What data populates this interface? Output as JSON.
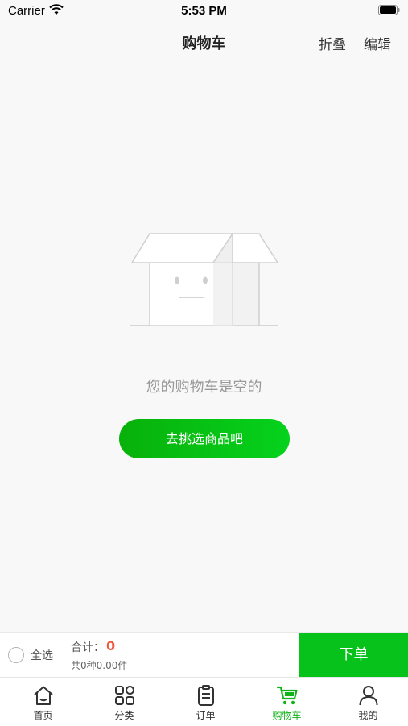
{
  "status_bar": {
    "carrier": "Carrier",
    "time": "5:53 PM",
    "icons": [
      "wifi-icon",
      "battery-icon"
    ]
  },
  "header": {
    "title": "购物车",
    "fold_label": "折叠",
    "edit_label": "编辑"
  },
  "empty_state": {
    "illustration": "empty-box-icon",
    "message": "您的购物车是空的",
    "button_label": "去挑选商品吧"
  },
  "checkout": {
    "select_all_label": "全选",
    "total_label": "合计：",
    "total_value": "0",
    "count_text": "共0种0.00件",
    "order_button_label": "下单"
  },
  "tabs": [
    {
      "label": "首页",
      "icon": "home-icon"
    },
    {
      "label": "分类",
      "icon": "category-icon"
    },
    {
      "label": "订单",
      "icon": "order-icon"
    },
    {
      "label": "购物车",
      "icon": "cart-icon"
    },
    {
      "label": "我的",
      "icon": "user-icon"
    }
  ],
  "active_tab": "购物车",
  "colors": {
    "accent_green": "#06c21a",
    "total_red": "#f05a3a",
    "background": "#f8f8f8"
  }
}
